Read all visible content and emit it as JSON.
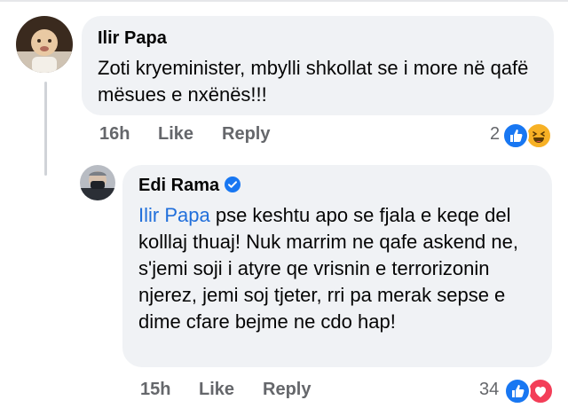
{
  "comments": [
    {
      "author": "Ilir Papa",
      "text": "Zoti kryeminister, mbylli shkollat se i more në qafë mësues e nxënës!!!",
      "time": "16h",
      "like_label": "Like",
      "reply_label": "Reply",
      "reaction_count": "2",
      "reactions": [
        "like-icon",
        "haha-icon"
      ]
    },
    {
      "author": "Edi Rama",
      "verified": true,
      "mention": "Ilir Papa",
      "text": " pse keshtu apo se fjala e keqe del kolllaj thuaj! Nuk marrim ne qafe askend ne, s'jemi soji i atyre qe vrisnin e terrorizonin njerez, jemi soj tjeter, rri pa merak sepse e dime cfare bejme ne cdo hap!",
      "time": "15h",
      "like_label": "Like",
      "reply_label": "Reply",
      "reaction_count": "34",
      "reactions": [
        "like-icon",
        "love-icon"
      ]
    }
  ],
  "colors": {
    "bubble": "#f0f2f5",
    "mention": "#216fdb",
    "meta": "#65676b",
    "like": "#1877f2",
    "love": "#f33e58",
    "haha": "#f7b125"
  }
}
